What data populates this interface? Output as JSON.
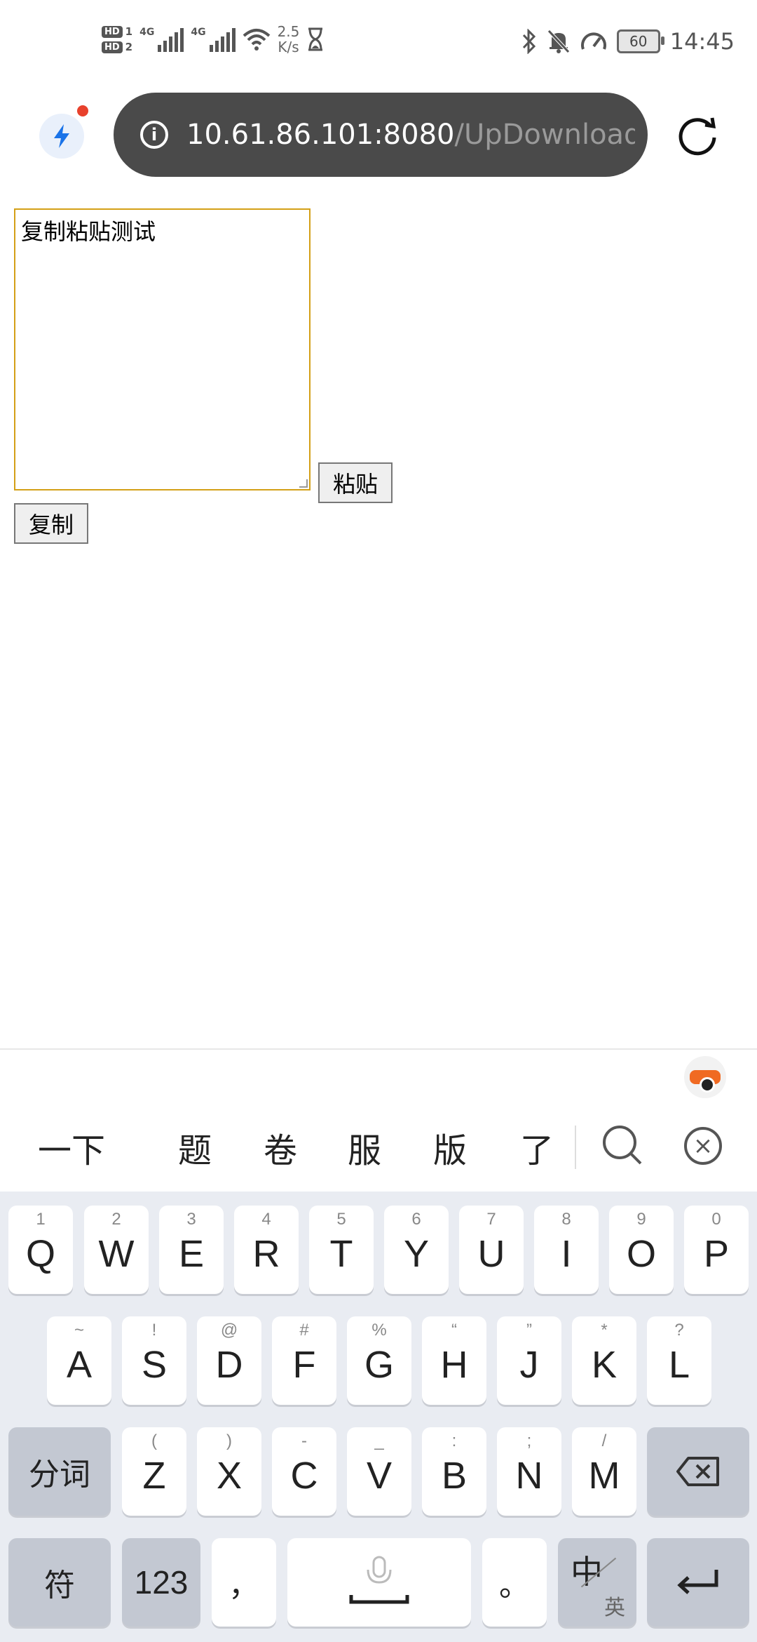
{
  "status_bar": {
    "hd1": "HD",
    "sim1": "1",
    "hd2": "HD",
    "sim2": "2",
    "net1": "4G",
    "net2": "4G",
    "speed_value": "2.5",
    "speed_unit": "K/s",
    "battery": "60",
    "time": "14:45",
    "icons": [
      "bluetooth-icon",
      "mute-icon",
      "speedometer-icon",
      "hourglass-icon",
      "wifi-icon"
    ]
  },
  "browser": {
    "url_host": "10.61.86.101:8080",
    "url_path": "/UpDownloadFile:",
    "icons": [
      "bolt-icon",
      "info-icon",
      "reload-icon"
    ]
  },
  "page": {
    "textarea_value": "复制粘贴测试",
    "paste_button": "粘贴",
    "copy_button": "复制"
  },
  "keyboard": {
    "candidates": [
      "一下",
      "题",
      "卷",
      "服",
      "版",
      "了"
    ],
    "row1": [
      {
        "hint": "1",
        "key": "Q"
      },
      {
        "hint": "2",
        "key": "W"
      },
      {
        "hint": "3",
        "key": "E"
      },
      {
        "hint": "4",
        "key": "R"
      },
      {
        "hint": "5",
        "key": "T"
      },
      {
        "hint": "6",
        "key": "Y"
      },
      {
        "hint": "7",
        "key": "U"
      },
      {
        "hint": "8",
        "key": "I"
      },
      {
        "hint": "9",
        "key": "O"
      },
      {
        "hint": "0",
        "key": "P"
      }
    ],
    "row2": [
      {
        "hint": "~",
        "key": "A"
      },
      {
        "hint": "!",
        "key": "S"
      },
      {
        "hint": "@",
        "key": "D"
      },
      {
        "hint": "#",
        "key": "F"
      },
      {
        "hint": "%",
        "key": "G"
      },
      {
        "hint": "“",
        "key": "H"
      },
      {
        "hint": "”",
        "key": "J"
      },
      {
        "hint": "*",
        "key": "K"
      },
      {
        "hint": "?",
        "key": "L"
      }
    ],
    "row3": [
      {
        "hint": "(",
        "key": "Z"
      },
      {
        "hint": ")",
        "key": "X"
      },
      {
        "hint": "-",
        "key": "C"
      },
      {
        "hint": "_",
        "key": "V"
      },
      {
        "hint": ":",
        "key": "B"
      },
      {
        "hint": ";",
        "key": "N"
      },
      {
        "hint": "/",
        "key": "M"
      }
    ],
    "segment_key": "分词",
    "symbol_key": "符",
    "numbers_key": "123",
    "comma_key": "，",
    "period_key": "。",
    "lang_main": "中",
    "lang_sub": "英",
    "accent_color": "#c3c8d2"
  }
}
